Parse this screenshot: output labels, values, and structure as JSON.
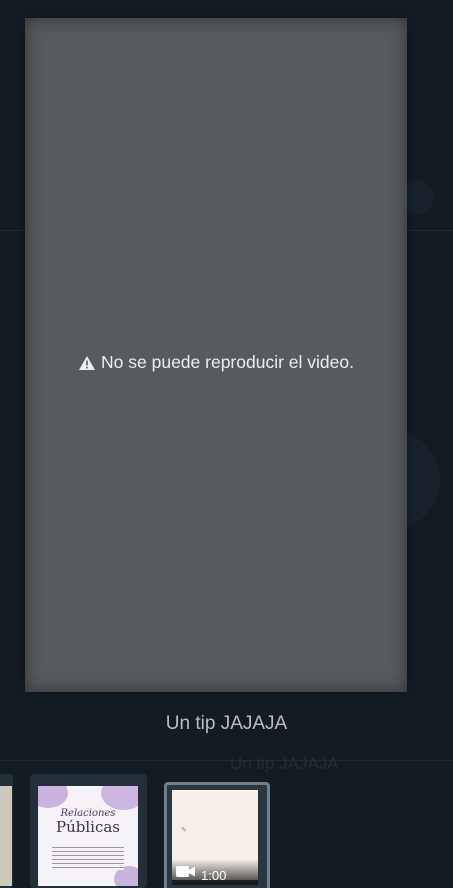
{
  "viewer": {
    "error_message": "No se puede reproducir el video.",
    "error_icon": "warning-icon"
  },
  "caption": "Un tip JAJAJA",
  "thumbnails": [
    {
      "kind": "image",
      "label": ""
    },
    {
      "kind": "image",
      "title_script": "Relaciones",
      "title_main": "Públicas"
    },
    {
      "kind": "video",
      "duration": "1:00",
      "icon": "video-camera-icon"
    }
  ],
  "background": {
    "ghost_caption": "Un tip JAJAJA"
  },
  "colors": {
    "backdrop": "#141c23",
    "viewer": "#585b5e",
    "caption_text": "#b8bec3",
    "selected_border": "#6f7f8c"
  }
}
